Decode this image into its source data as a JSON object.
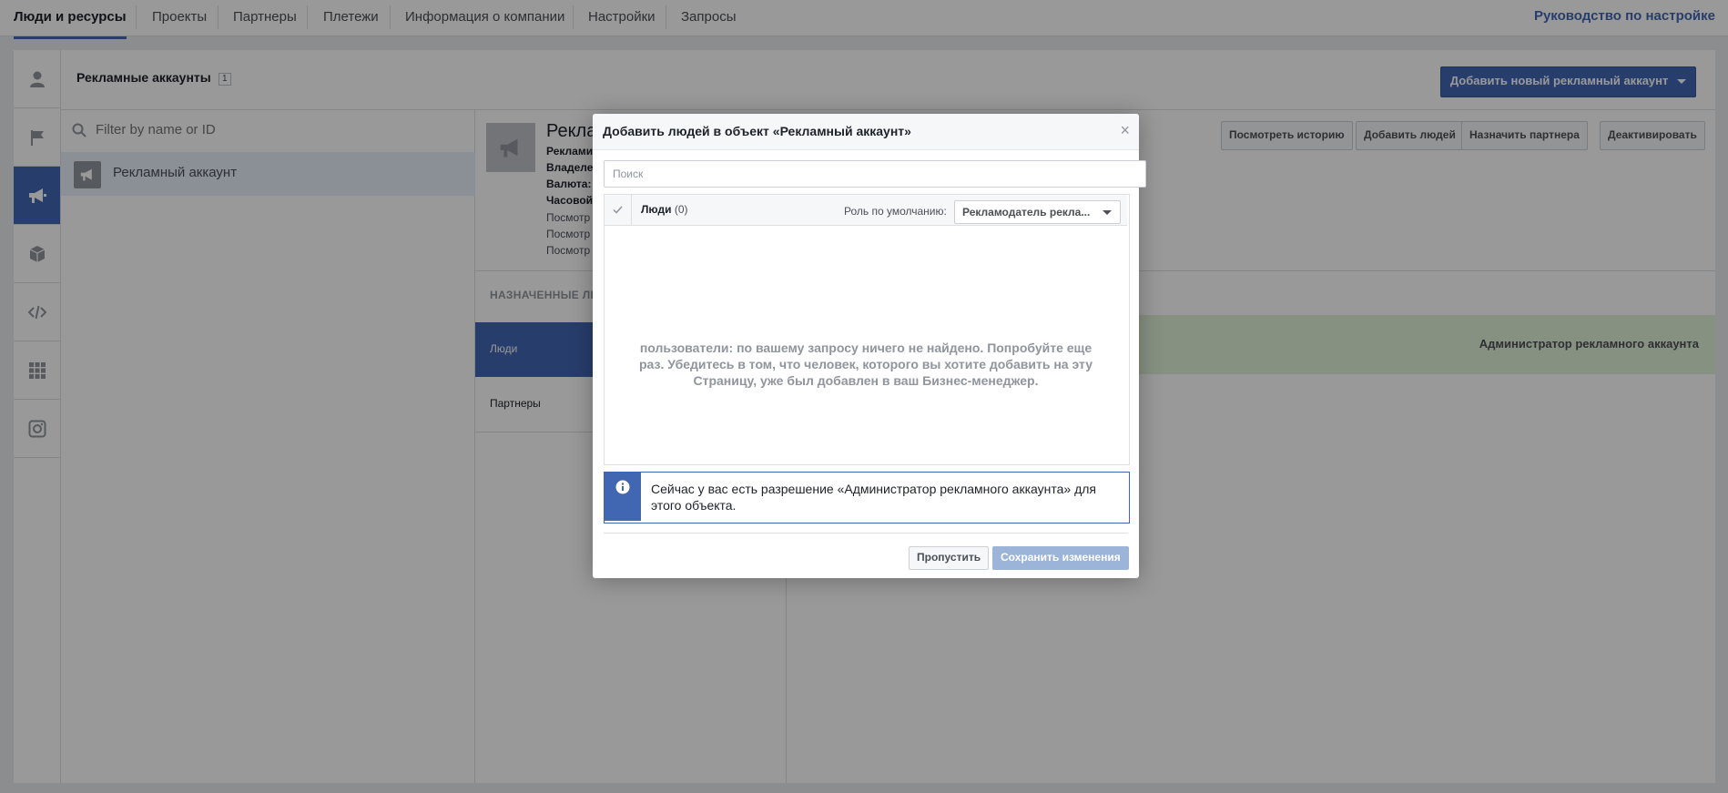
{
  "nav": {
    "tabs": [
      "Люди и ресурсы",
      "Проекты",
      "Партнеры",
      "Плетежи",
      "Информация о компании",
      "Настройки",
      "Запросы"
    ],
    "active_index": 0,
    "guide_link": "Руководство по настройке"
  },
  "rail": {
    "icons": [
      "person-icon",
      "flag-icon",
      "megaphone-icon",
      "cube-icon",
      "code-icon",
      "grid-icon",
      "instagram-icon"
    ],
    "active_index": 2
  },
  "subheader": {
    "title": "Рекламные аккаунты",
    "count": "1",
    "add_button": "Добавить новый рекламный аккаунт"
  },
  "list": {
    "filter_placeholder": "Filter by name or ID",
    "items": [
      "Рекламный аккаунт"
    ]
  },
  "detail": {
    "title": "Рекла",
    "lines": [
      {
        "bold": "Реклами",
        "text": ""
      },
      {
        "bold": "Владеле",
        "text": ""
      },
      {
        "bold": "Валюта:",
        "text": ""
      },
      {
        "bold": "Часовой",
        "text": ""
      },
      {
        "bold": "",
        "text": "Посмотр"
      },
      {
        "bold": "",
        "text": "Посмотр"
      },
      {
        "bold": "",
        "text": "Посмотр"
      }
    ],
    "buttons": [
      "Посмотреть историю",
      "Добавить людей",
      "Назначить партнера",
      "Деактивировать"
    ],
    "assigned_header": "НАЗНАЧЕННЫЕ ЛЮ",
    "assigned_people": "Люди",
    "assigned_partners": "Партнеры",
    "role": "Администратор рекламного аккаунта"
  },
  "modal": {
    "title": "Добавить людей в объект «Рекламный аккаунт»",
    "close_glyph": "×",
    "search_placeholder": "Поиск",
    "people_label": "Люди",
    "people_count": "(0)",
    "role_label": "Роль по умолчанию:",
    "role_value": "Рекламодатель рекла...",
    "empty_message": "пользователи: по вашему запросу ничего не найдено. Попробуйте еще раз. Убедитесь в том, что человек, которого вы хотите добавить на эту Страницу, уже был добавлен в ваш Бизнес-менеджер.",
    "info_text": "Сейчас у вас есть разрешение «Администратор рекламного аккаунта» для этого объекта.",
    "skip_button": "Пропустить",
    "save_button": "Сохранить изменения"
  },
  "colors": {
    "accent": "#4267b2",
    "disabled_button": "#9cb4d8",
    "role_row": "#e1f2d7"
  }
}
